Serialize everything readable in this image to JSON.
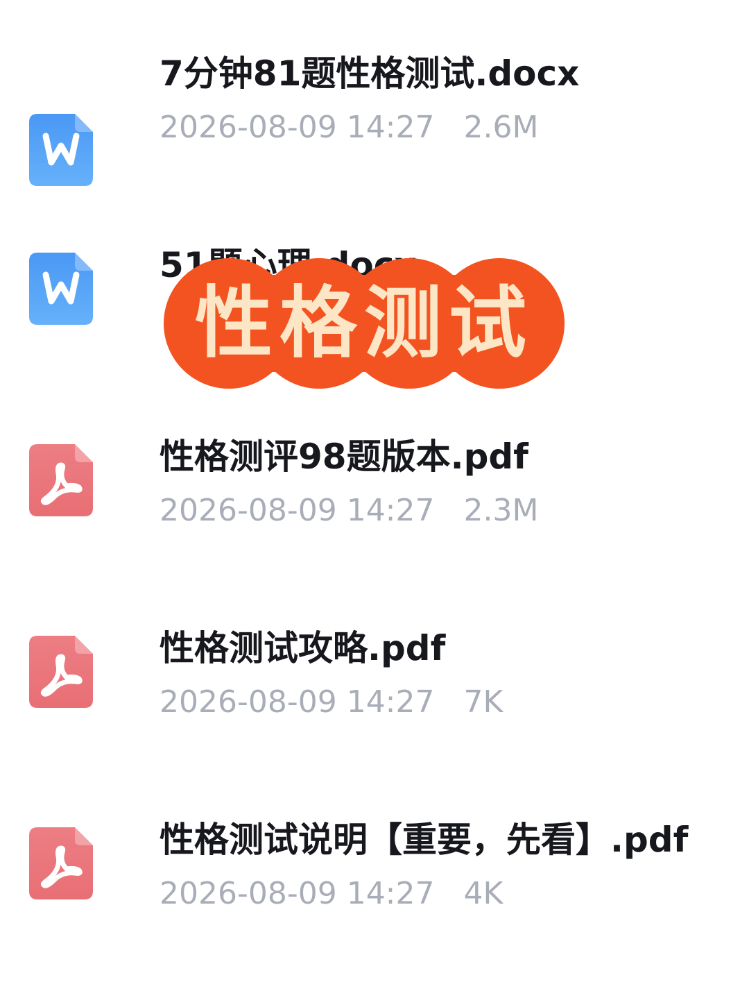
{
  "files": [
    {
      "type": "word",
      "icon": "word-doc-icon",
      "name": "7分钟81题性格测试.docx",
      "date": "2026-08-09 14:27",
      "size": "2.6M"
    },
    {
      "type": "word",
      "icon": "word-doc-icon",
      "name": "51题心理.docx",
      "date": "",
      "size": ""
    },
    {
      "type": "pdf",
      "icon": "pdf-icon",
      "name": "性格测评98题版本.pdf",
      "date": "2026-08-09 14:27",
      "size": "2.3M"
    },
    {
      "type": "pdf",
      "icon": "pdf-icon",
      "name": "性格测试攻略.pdf",
      "date": "2026-08-09 14:27",
      "size": "7K"
    },
    {
      "type": "pdf",
      "icon": "pdf-icon",
      "name": "性格测试说明【重要，先看】.pdf",
      "date": "2026-08-09 14:27",
      "size": "4K"
    }
  ],
  "banner": {
    "text": "性格测试"
  },
  "colors": {
    "word_icon": "#4a9cf5",
    "pdf_icon": "#ea7b80",
    "banner_bg": "#f35320",
    "banner_text": "#fde6c6",
    "file_name": "#16181d",
    "meta_text": "#a9adb8"
  }
}
